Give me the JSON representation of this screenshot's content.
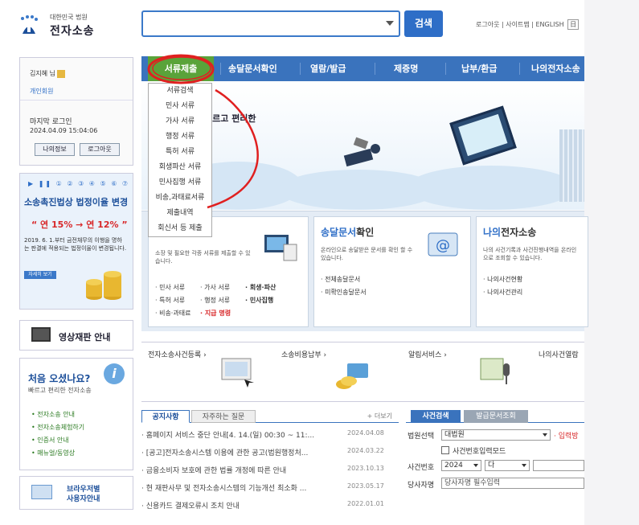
{
  "logo": {
    "sub": "대한민국 법원",
    "main": "전자소송"
  },
  "search": {
    "placeholder": "",
    "button": "검색"
  },
  "toplinks": {
    "logout": "로그아웃",
    "sitemap": "사이트맵",
    "english": "ENGLISH",
    "lang_box": "日"
  },
  "login": {
    "name": "김지혜 님",
    "type": "개인회원",
    "last_login_label": "마지막 로그인",
    "last_login": "2024.04.09 15:04:06",
    "my_info": "나의정보",
    "logout": "로그아웃"
  },
  "promo": {
    "dots": "▶ ❚❚ ① ② ③ ④ ⑤ ⑥ ⑦",
    "title": "소송촉진법상 법정이율 변경",
    "rate": "“ 연 15% → 연 12% ”",
    "desc": "2019. 6. 1.부터 금전채무의 이행을 명하는 판결에 적용되는 법정이율이 변경됩니다.",
    "more": "자세히 보기"
  },
  "video": {
    "label": "영상재판 안내"
  },
  "guide": {
    "title": "처음 오셨나요?",
    "subtitle": "빠르고 편리한 전자소송",
    "items": [
      "전자소송 안내",
      "전자소송체험하기",
      "인증서 안내",
      "매뉴얼/동영상"
    ]
  },
  "browser": {
    "line1": "브라우저별",
    "line2": "사용자안내"
  },
  "gnb": [
    "서류제출",
    "송달문서확인",
    "열람/발급",
    "제증명",
    "납부/환급",
    "나의전자소송"
  ],
  "dropdown": [
    "서류검색",
    "민사 서류",
    "가사 서류",
    "행정 서류",
    "특허 서류",
    "회생파산 서류",
    "민사집행 서류",
    "비송,과태료서류",
    "제출내역",
    "회신서 등 제출"
  ],
  "hero": {
    "text": "빠르고 편리한"
  },
  "cards": [
    {
      "title_a": "",
      "title_b": "",
      "desc": "소장 및 필요한 각종 서류를 제출할 수 있습니다.",
      "links": [
        [
          "· 민사 서류",
          "· 가사 서류",
          "· 회생·파산"
        ],
        [
          "· 특허 서류",
          "· 행정 서류",
          "· 민사집행"
        ],
        [
          "· 비송·과태료",
          "· 지급 명령",
          ""
        ]
      ]
    },
    {
      "title_a": "송달문서",
      "title_b": "확인",
      "desc": "온라인으로 송달받은 문서를 확인 할 수 있습니다.",
      "links": [
        [
          "· 전체송달문서"
        ],
        [
          "· 미확인송달문서"
        ]
      ]
    },
    {
      "title_a": "나의",
      "title_b": "전자소송",
      "desc": "나의 사건기록과 사건진행내역을 온라인으로 조회할 수 있습니다.",
      "links": [
        [
          "· 나의사건현황"
        ],
        [
          "· 나의사건관리"
        ]
      ]
    }
  ],
  "quick": [
    "전자소송사건등록 ›",
    "소송비용납부 ›",
    "알림서비스 ›",
    "나의사건열람"
  ],
  "notice": {
    "tab_on": "공지사항",
    "tab_off": "자주하는 질문",
    "more": "+ 더보기",
    "items": [
      {
        "title": "· 홈페이지 서비스 중단 안내[4. 14.(일) 00:30 ~ 11:...",
        "date": "2024.04.08"
      },
      {
        "title": "· [공고]전자소송시스템 이용에 관한 공고(법원행정처...",
        "date": "2024.03.22"
      },
      {
        "title": "· 금융소비자 보호에 관한 법률 개정에 따른 안내",
        "date": "2023.10.13"
      },
      {
        "title": "· 현 재판사무 및 전자소송시스템의 기능개선 최소화 ...",
        "date": "2023.05.17"
      },
      {
        "title": "· 신용카드 결제오류시 조치 안내",
        "date": "2022.01.01"
      }
    ]
  },
  "casesearch": {
    "tab_on": "사건검색",
    "tab_off": "발급문서조회",
    "court_label": "법원선택",
    "court_value": "대법원",
    "court_hint": "· 입력방",
    "manual_mode": "사건번호입력모드",
    "case_label": "사건번호",
    "year": "2024",
    "kind": "다",
    "party_label": "당사자명",
    "party_value": "당사자명 필수입력"
  },
  "colors": {
    "nav": "#3a73bd",
    "active": "#5aa33a",
    "annotation": "#e02020"
  }
}
